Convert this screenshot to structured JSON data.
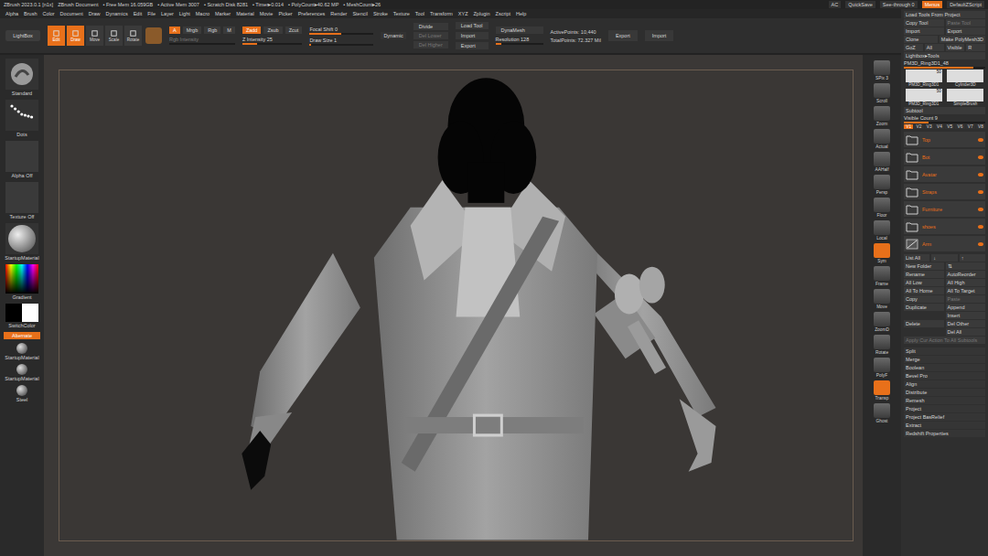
{
  "title_bar": {
    "app": "ZBrush 2023.0.1 [n1x]",
    "document": "ZBrush Document",
    "stats": [
      "• Free Mem 16.059GB",
      "• Active Mem 3007",
      "• Scratch Disk 8281",
      "• Timer▸0.014",
      "• PolyCount▸40.62 MP",
      "• MeshCount▸26"
    ],
    "right": [
      {
        "label": "AC",
        "selected": false
      },
      {
        "label": "QuickSave",
        "selected": false
      },
      {
        "label": "See-through 0",
        "selected": false
      },
      {
        "label": "Menus",
        "selected": true
      },
      {
        "label": "DefaultZScript",
        "selected": false
      }
    ]
  },
  "menu": [
    "Alpha",
    "Brush",
    "Color",
    "Document",
    "Draw",
    "Dynamics",
    "Edit",
    "File",
    "Layer",
    "Light",
    "Macro",
    "Marker",
    "Material",
    "Movie",
    "Picker",
    "Preferences",
    "Render",
    "Stencil",
    "Stroke",
    "Texture",
    "Tool",
    "Transform",
    "XYZ",
    "Zplugin",
    "Zscript",
    "Help"
  ],
  "toolbar": {
    "lightbox": "LightBox",
    "modes": [
      {
        "label": "Edit",
        "selected": true
      },
      {
        "label": "Draw",
        "selected": true
      },
      {
        "label": "Move",
        "selected": false
      },
      {
        "label": "Scale",
        "selected": false
      },
      {
        "label": "Rotate",
        "selected": false
      }
    ],
    "channels": [
      {
        "label": "A",
        "selected": true
      },
      {
        "label": "Mrgb",
        "selected": false
      },
      {
        "label": "Rgb",
        "selected": false
      },
      {
        "label": "M",
        "selected": false
      }
    ],
    "zmodes": [
      {
        "label": "Zadd",
        "selected": true
      },
      {
        "label": "Zsub",
        "selected": false
      },
      {
        "label": "Zcut",
        "selected": false
      }
    ],
    "intensity": [
      {
        "label": "Rgb Intensity",
        "level": 0.0,
        "disabled": true
      },
      {
        "label": "Z Intensity 25",
        "level": 0.25,
        "disabled": false
      }
    ],
    "brush_sliders": [
      {
        "label": "Focal Shift 0",
        "level": 0.5,
        "disabled": false
      },
      {
        "label": "Draw Size 1",
        "level": 0.02,
        "disabled": false
      }
    ],
    "dynamic": "Dynamic",
    "geometry": [
      {
        "label": "Divide",
        "disabled": false
      },
      {
        "label": "Del Lower",
        "disabled": true
      },
      {
        "label": "Del Higher",
        "disabled": true
      }
    ],
    "tool_buttons": [
      {
        "label": "Load Tool",
        "disabled": false
      },
      {
        "label": "Import",
        "disabled": false
      },
      {
        "label": "Export",
        "disabled": false
      }
    ],
    "dynamesh": "DynaMesh",
    "resolution": {
      "label": "Resolution 128",
      "level": 0.12
    },
    "points": [
      "ActivePoints: 10,440",
      "TotalPoints: 72.327 Mil"
    ],
    "end_buttons": [
      "Export",
      "Import"
    ]
  },
  "left_shelf": [
    {
      "kind": "brush",
      "label": "Standard",
      "selected": false
    },
    {
      "kind": "stroke",
      "label": "Dots",
      "selected": false
    },
    {
      "kind": "alpha",
      "label": "Alpha Off",
      "selected": false
    },
    {
      "kind": "texture",
      "label": "Texture Off",
      "selected": false
    },
    {
      "kind": "material",
      "label": "StartupMaterial",
      "selected": false
    },
    {
      "kind": "picker",
      "label": "Gradient",
      "selected": false
    },
    {
      "kind": "swatch",
      "label": "SwitchColor",
      "selected": false
    },
    {
      "kind": "button",
      "label": "Alternate",
      "selected": true
    },
    {
      "kind": "small",
      "label": "StartupMaterial",
      "selected": false
    },
    {
      "kind": "small",
      "label": "StartupMaterial",
      "selected": false
    },
    {
      "kind": "small",
      "label": "Steel",
      "selected": false
    }
  ],
  "right_shelf": [
    {
      "label": "SPix 3",
      "selected": false
    },
    {
      "label": "Scroll",
      "selected": false
    },
    {
      "label": "Zoom",
      "selected": false
    },
    {
      "label": "Actual",
      "selected": false
    },
    {
      "label": "AAHalf",
      "selected": false
    },
    {
      "label": "Persp",
      "selected": false
    },
    {
      "label": "Floor",
      "selected": false
    },
    {
      "label": "Local",
      "selected": false
    },
    {
      "label": "Sym",
      "selected": true
    },
    {
      "label": "Frame",
      "selected": false
    },
    {
      "label": "Move",
      "selected": false
    },
    {
      "label": "ZoomD",
      "selected": false
    },
    {
      "label": "Rotate",
      "selected": false
    },
    {
      "label": "PolyF",
      "selected": false
    },
    {
      "label": "Transp",
      "selected": true
    },
    {
      "label": "Ghost",
      "selected": false
    }
  ],
  "right_panel": {
    "top_rows": [
      [
        {
          "label": "Load Tools From Project",
          "disabled": false
        }
      ],
      [
        {
          "label": "Copy Tool",
          "disabled": false
        },
        {
          "label": "Paste Tool",
          "disabled": true
        }
      ],
      [
        {
          "label": "Import",
          "disabled": false
        },
        {
          "label": "Export",
          "disabled": false
        }
      ],
      [
        {
          "label": "Clone",
          "disabled": false
        },
        {
          "label": "Make PolyMesh3D",
          "disabled": false
        }
      ],
      [
        {
          "label": "GoZ",
          "disabled": false
        },
        {
          "label": "All",
          "disabled": false
        },
        {
          "label": "Visible",
          "disabled": false
        },
        {
          "label": "R",
          "disabled": false
        }
      ],
      [
        {
          "label": "Lightbox▸Tools",
          "disabled": false
        }
      ]
    ],
    "current_tool": {
      "label": "PM3D_Ring3D1_48",
      "level": 0.85
    },
    "thumbs": [
      {
        "label": "PM3D_Ring3D1",
        "count": "50"
      },
      {
        "label": "Cylinder3D",
        "count": ""
      },
      {
        "label": "PM3D_Ring3D1",
        "count": "50"
      },
      {
        "label": "SimpleBrush",
        "count": ""
      }
    ],
    "subtool_title": "Subtool",
    "visible_count": {
      "label": "Visible Count 9",
      "level": 0.3
    },
    "versions": [
      {
        "label": "V1",
        "selected": true
      },
      {
        "label": "V2",
        "selected": false
      },
      {
        "label": "V3",
        "selected": false
      },
      {
        "label": "V4",
        "selected": false
      },
      {
        "label": "V5",
        "selected": false
      },
      {
        "label": "V6",
        "selected": false
      },
      {
        "label": "V7",
        "selected": false
      },
      {
        "label": "V8",
        "selected": false
      }
    ],
    "subtools": [
      {
        "name": "Top",
        "kind": "folder",
        "visible": true
      },
      {
        "name": "Bot",
        "kind": "folder",
        "visible": true
      },
      {
        "name": "Avatar",
        "kind": "folder",
        "visible": true
      },
      {
        "name": "Straps",
        "kind": "folder",
        "visible": true
      },
      {
        "name": "Furniture",
        "kind": "folder",
        "visible": true
      },
      {
        "name": "shoes",
        "kind": "folder",
        "visible": true
      },
      {
        "name": "Arm",
        "kind": "mesh",
        "visible": true
      }
    ],
    "action_rows": [
      [
        {
          "label": "List All",
          "disabled": false
        },
        {
          "label": "↓",
          "disabled": false
        },
        {
          "label": "↑",
          "disabled": false
        }
      ],
      [
        {
          "label": "New Folder",
          "disabled": false
        },
        {
          "label": "⇅",
          "disabled": false
        }
      ],
      [
        {
          "label": "Rename",
          "disabled": false
        },
        {
          "label": "AutoReorder",
          "disabled": false
        }
      ],
      [
        {
          "label": "All Low",
          "disabled": false
        },
        {
          "label": "All High",
          "disabled": false
        }
      ],
      [
        {
          "label": "All To Home",
          "disabled": false
        },
        {
          "label": "All To Target",
          "disabled": false
        }
      ],
      [
        {
          "label": "Copy",
          "disabled": false
        },
        {
          "label": "Paste",
          "disabled": true
        }
      ],
      [
        {
          "label": "Duplicate",
          "disabled": false
        },
        {
          "label": "Append",
          "disabled": false
        }
      ],
      [
        {
          "label": "",
          "disabled": false
        },
        {
          "label": "Insert",
          "disabled": false
        }
      ],
      [
        {
          "label": "Delete",
          "disabled": false
        },
        {
          "label": "Del Other",
          "disabled": false
        }
      ],
      [
        {
          "label": "",
          "disabled": false
        },
        {
          "label": "Del All",
          "disabled": false
        }
      ],
      [
        {
          "label": "Apply Cur Action To All Subtools",
          "disabled": true
        }
      ]
    ],
    "sections": [
      "Split",
      "Merge",
      "Boolean",
      "Bevel Pro",
      "Align",
      "Distribute",
      "Remesh",
      "Project",
      "Project BasRelief",
      "Extract",
      "Redshift Properties"
    ]
  }
}
